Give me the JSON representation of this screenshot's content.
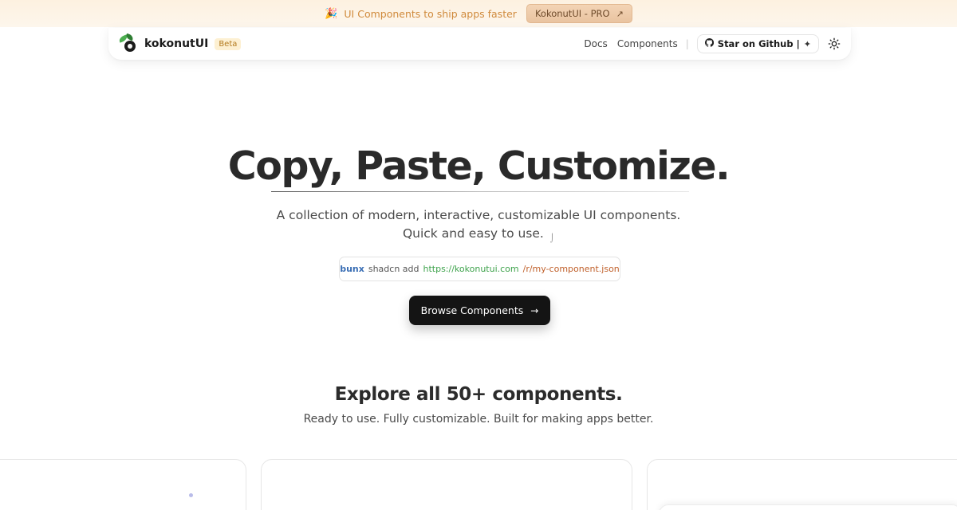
{
  "promo": {
    "icon": "party-popper-icon",
    "text": "UI Components to ship apps faster",
    "button_label": "KokonutUI - PRO",
    "button_icon": "arrow-up-right-icon",
    "colors": {
      "text": "#d08a3c",
      "button_bg": "#f3d4b5"
    }
  },
  "nav": {
    "brand": "kokonutUI",
    "badge": "Beta",
    "links": [
      {
        "label": "Docs"
      },
      {
        "label": "Components"
      }
    ],
    "separator": "|",
    "star_label": "Star on Github |",
    "theme_icon": "sun-icon"
  },
  "hero": {
    "title": "Copy, Paste, Customize.",
    "subtitle_line1": "A collection of modern, interactive, customizable UI components.",
    "subtitle_line2": "Quick and easy to use."
  },
  "command": {
    "part1": "bunx",
    "part2": "shadcn add",
    "part3": "https://kokonutui.com",
    "part4": "/r/my-component.json"
  },
  "cta": {
    "label": "Browse Components",
    "icon": "arrow-right-icon"
  },
  "explore": {
    "title": "Explore all 50+ components.",
    "subtitle": "Ready to use. Fully customizable. Built for making apps better."
  }
}
